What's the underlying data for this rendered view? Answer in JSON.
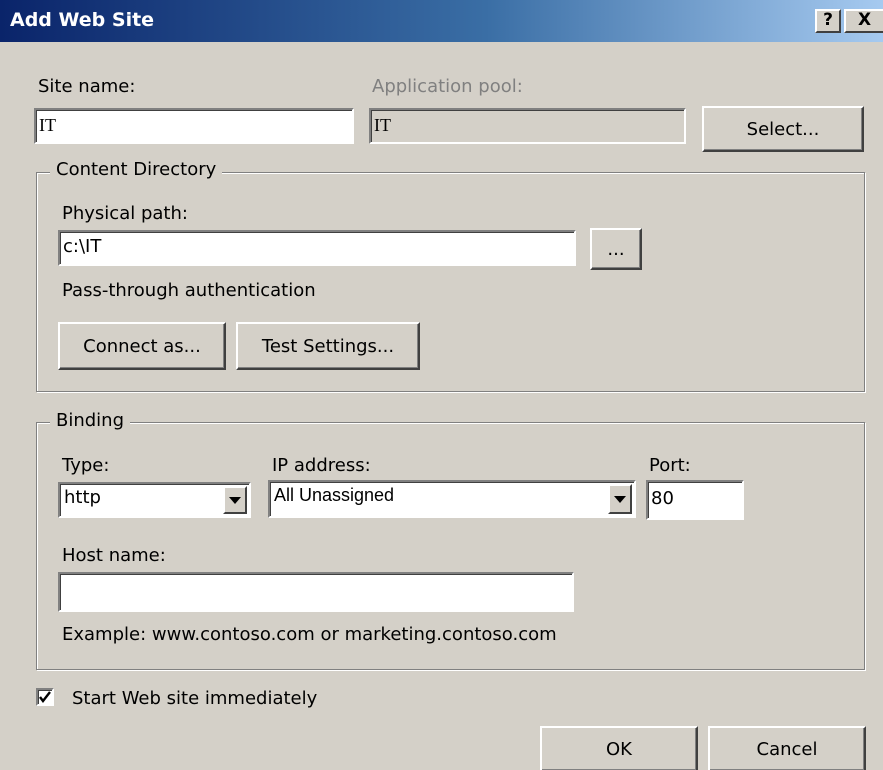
{
  "window": {
    "title": "Add Web Site",
    "help_label": "?",
    "close_label": "X"
  },
  "site": {
    "site_name_label": "Site name:",
    "site_name_value": "IT",
    "app_pool_label": "Application pool:",
    "app_pool_value": "IT",
    "select_label": "Select..."
  },
  "content_directory": {
    "group_label": "Content Directory",
    "physical_path_label": "Physical path:",
    "physical_path_value": "c:\\IT",
    "browse_label": "...",
    "pass_through_label": "Pass-through authentication",
    "connect_as_label": "Connect as...",
    "test_settings_label": "Test Settings..."
  },
  "binding": {
    "group_label": "Binding",
    "type_label": "Type:",
    "type_value": "http",
    "ip_label": "IP address:",
    "ip_value": "All Unassigned",
    "port_label": "Port:",
    "port_value": "80",
    "host_label": "Host name:",
    "host_value": "",
    "example_text": "Example: www.contoso.com or marketing.contoso.com"
  },
  "start_immediately": {
    "label": "Start Web site immediately",
    "checked": true
  },
  "footer": {
    "ok_label": "OK",
    "cancel_label": "Cancel"
  },
  "colors": {
    "dialog_face": "#d4d0c8",
    "title_gradient_start": "#0a246a",
    "title_gradient_end": "#a6caf0",
    "disabled_text": "#808080"
  },
  "icons": [
    "help-icon",
    "close-icon",
    "chevron-down-icon",
    "checkmark-icon"
  ]
}
